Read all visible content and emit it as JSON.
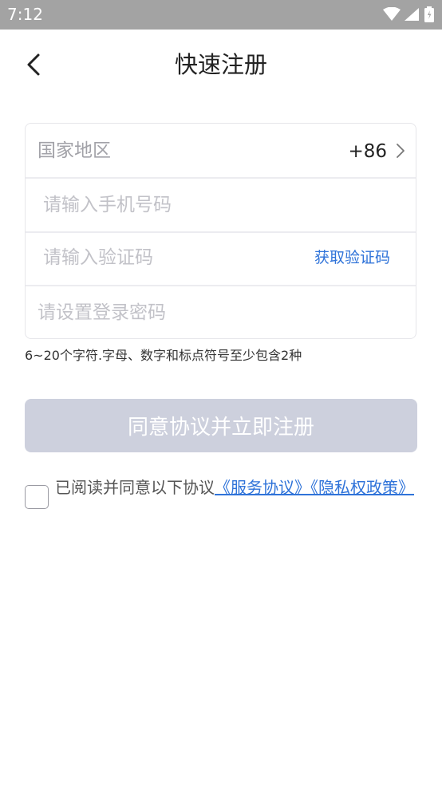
{
  "status": {
    "time": "7:12"
  },
  "header": {
    "title": "快速注册"
  },
  "form": {
    "country_label": "国家地区",
    "country_code": "+86",
    "phone_placeholder": "请输入手机号码",
    "code_placeholder": "请输入验证码",
    "get_code_label": "获取验证码",
    "password_placeholder": "请设置登录密码"
  },
  "hint": "6~20个字符.字母、数字和标点符号至少包含2种",
  "submit_label": "同意协议并立即注册",
  "agreement": {
    "prefix": "已阅读并同意以下协议",
    "service_link": "《服务协议》",
    "privacy_link": "《隐私权政策》",
    "checked": false
  },
  "colors": {
    "status_bar": "#a3a3a3",
    "accent": "#2f73d9",
    "button_disabled": "#cdd0dd"
  }
}
